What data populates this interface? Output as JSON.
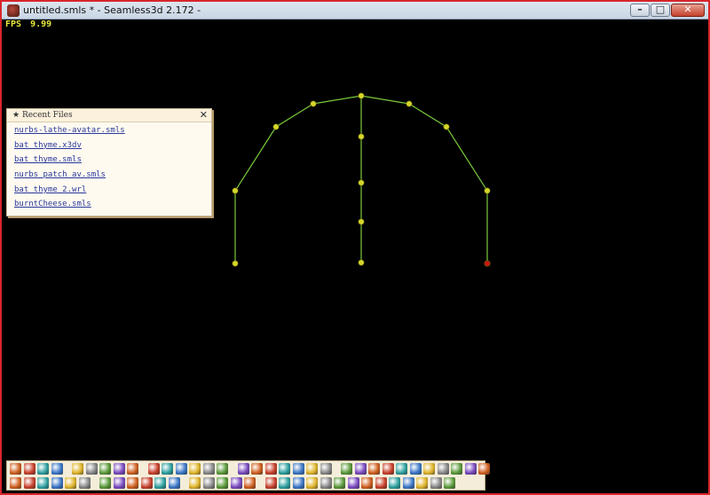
{
  "window": {
    "title": "untitled.smls * - Seamless3d 2.172 -",
    "controls": [
      "minimize",
      "maximize",
      "close"
    ]
  },
  "fps": {
    "label": "FPS",
    "value": "9.99"
  },
  "recent_files": {
    "title": "Recent Files",
    "items": [
      "nurbs-lathe-avatar.smls",
      "bat thyme.x3dv",
      "bat thyme.smls",
      "nurbs patch av.smls",
      "bat thyme 2.wrl",
      "burntCheese.smls"
    ]
  },
  "viewport": {
    "line_color": "#7ac83a",
    "point_color": "#d6d62a",
    "selected_point_color": "#cc1010"
  },
  "toolbar": {
    "row1_icons": [
      "new-file-icon",
      "open-file-icon",
      "print-icon",
      "save-icon",
      "folder-icon",
      "tree-icon",
      "copy-icon",
      "undo-icon",
      "redo-icon",
      "sphere-icon",
      "palette-icon",
      "texture-icon",
      "grid-icon",
      "window-icon",
      "printer-icon",
      "camera-icon",
      "globe-icon",
      "globe-icon",
      "globe-icon",
      "globe-icon",
      "globe-icon",
      "globe-icon",
      "cylinder-icon",
      "move-icon",
      "move-icon",
      "rotate-icon",
      "scale-icon",
      "target-icon",
      "target-icon",
      "face-icon",
      "figure-icon",
      "bone-icon",
      "help-icon"
    ],
    "row2_icons": [
      "sphere-icon",
      "box-icon",
      "cone-icon",
      "cylinder-icon",
      "node-icon",
      "cube-icon",
      "no-icon",
      "grid-icon",
      "joint-icon",
      "color-icon",
      "select-icon",
      "rectangle-icon",
      "tool-icon",
      "vertex-icon",
      "vertex-icon",
      "edge-icon",
      "face-icon",
      "triangle-icon",
      "plane-icon",
      "mesh-icon",
      "shape-icon",
      "move-icon",
      "arrow-icon",
      "arrow-icon",
      "text-icon",
      "pen-icon",
      "zoom-icon",
      "image-icon",
      "layer-icon",
      "compass-icon",
      "sun-icon"
    ],
    "colors": [
      "#3b77c7",
      "#5a9a3a",
      "#c8412c",
      "#e0b52b",
      "#7a4ac0",
      "#2ea0a0",
      "#888888",
      "#d06020"
    ]
  }
}
